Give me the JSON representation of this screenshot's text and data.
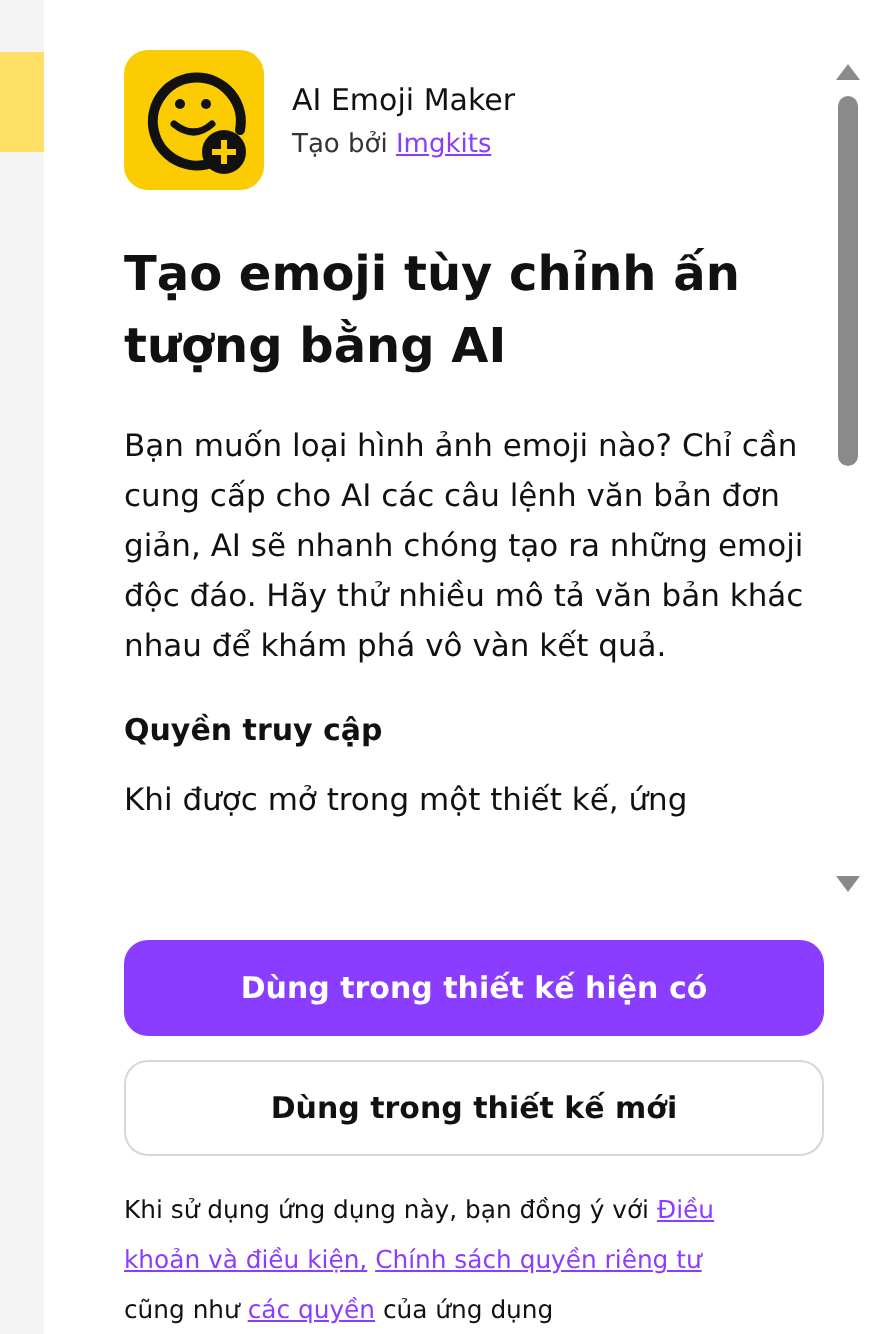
{
  "app": {
    "name": "AI Emoji Maker",
    "byline": "Tạo bởi",
    "author": "Imgkits"
  },
  "title": "Tạo emoji tùy chỉnh ấn tượng bằng AI",
  "description": "Bạn muốn loại hình ảnh emoji nào? Chỉ cần cung cấp cho AI các câu lệnh văn bản đơn giản, AI sẽ nhanh chóng tạo ra những emoji độc đáo. Hãy thử nhiều mô tả văn bản khác nhau để khám phá vô vàn kết quả.",
  "access": {
    "heading": "Quyền truy cập",
    "text": "Khi được mở trong một thiết kế, ứng"
  },
  "buttons": [
    {
      "label": "Dùng trong thiết kế hiện có",
      "kind": "primary"
    },
    {
      "label": "Dùng trong thiết kế mới",
      "kind": "secondary"
    }
  ],
  "footer": [
    {
      "kind": "text",
      "text": "Khi sử dụng ứng dụng này, bạn đồng ý với"
    },
    {
      "kind": "link",
      "text": "Điều"
    },
    {
      "kind": "link",
      "text": "khoản và điều kiện,"
    },
    {
      "kind": "link",
      "text": "Chính sách quyền riêng tư"
    },
    {
      "kind": "text",
      "text": "cũng như"
    },
    {
      "kind": "link",
      "text": "các quyền"
    },
    {
      "kind": "text",
      "text": "của ứng dụng"
    }
  ]
}
